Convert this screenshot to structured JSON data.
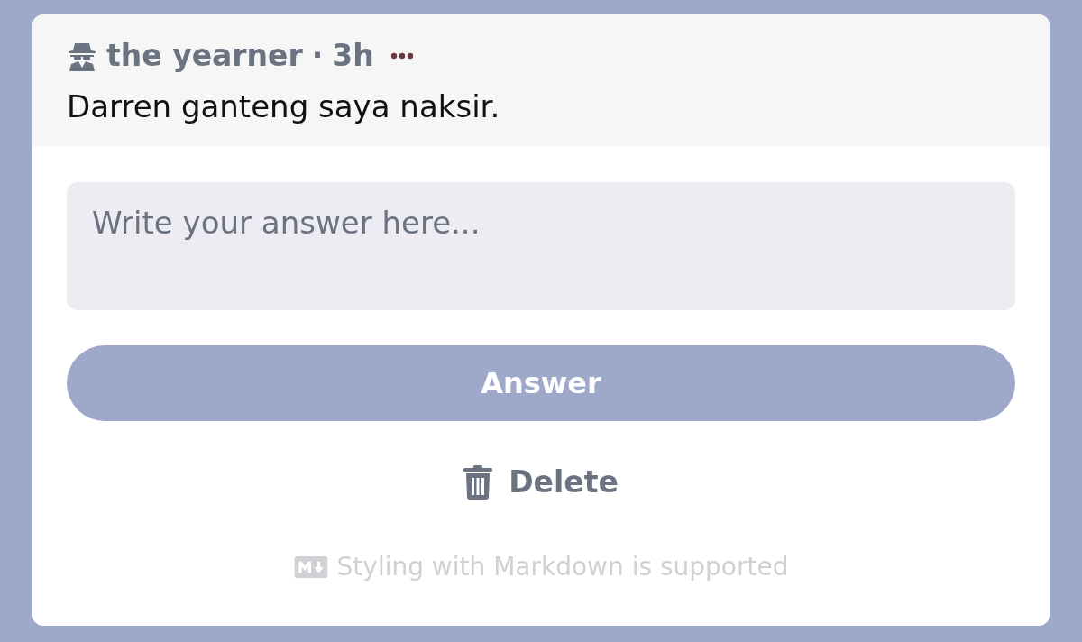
{
  "question": {
    "author": "the yearner",
    "separator": "·",
    "time": "3h",
    "text": "Darren ganteng saya naksir."
  },
  "answer_field": {
    "placeholder": "Write your answer here..."
  },
  "answer_button": {
    "label": "Answer"
  },
  "delete_button": {
    "label": "Delete"
  },
  "footer_note": "Styling with Markdown is supported"
}
